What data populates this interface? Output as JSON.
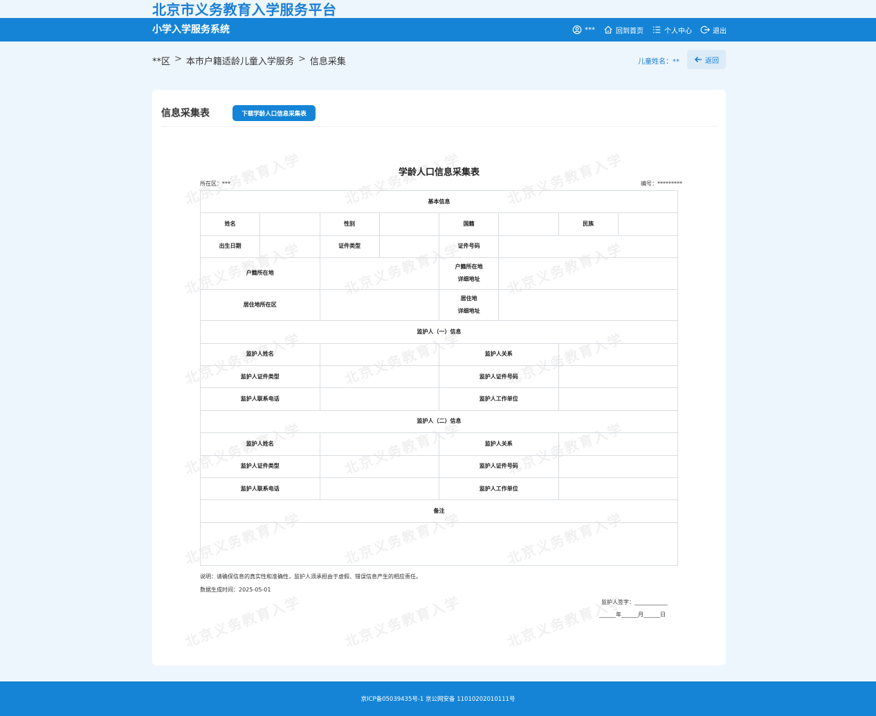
{
  "header": {
    "platform_title": "北京市义务教育入学服务平台",
    "system_title": "小学入学服务系统",
    "user_name": "***",
    "home_label": "回到首页",
    "center_label": "个人中心",
    "logout_label": "退出"
  },
  "breadcrumb": {
    "items": [
      "**区",
      "本市户籍适龄儿童入学服务",
      "信息采集"
    ],
    "separator": ">"
  },
  "child": {
    "label": "儿童姓名：**",
    "back_label": "返回"
  },
  "card": {
    "title": "信息采集表",
    "download_label": "下载学龄人口信息采集表"
  },
  "form": {
    "title": "学龄人口信息采集表",
    "district": "所在区：***",
    "serial": "编号：*********",
    "section_basic": "基本信息",
    "name": "姓名",
    "gender": "性别",
    "nationality": "国籍",
    "ethnicity": "民族",
    "birth_date": "出生日期",
    "id_type": "证件类型",
    "id_number": "证件号码",
    "hukou_district": "户籍所在地",
    "hukou_address_1": "户籍所在地",
    "hukou_address_2": "详细地址",
    "residence_district": "居住地所在区",
    "residence_address_1": "居住地",
    "residence_address_2": "详细地址",
    "guardian1_section": "监护人（一）信息",
    "guardian2_section": "监护人（二）信息",
    "guardian_name": "监护人姓名",
    "guardian_relation": "监护人关系",
    "guardian_id_type": "监护人证件类型",
    "guardian_id_number": "监护人证件号码",
    "guardian_phone": "监护人联系电话",
    "guardian_work": "监护人工作单位",
    "remark": "备注",
    "note": "说明：请确保信息的真实性和准确性，监护人须承担由于虚假、错误信息产生的相应责任。",
    "generated": "数据生成时间：2025-05-01",
    "signature": "监护人签字：____________",
    "date_line": "______年______月______日"
  },
  "watermark": "北京义务教育入学",
  "footer": {
    "text": "京ICP备05039435号-1 京公网安备 11010202010111号"
  },
  "colors": {
    "primary": "#1584d6",
    "title_blue": "#1a7fd4",
    "background": "#eef6fd"
  }
}
